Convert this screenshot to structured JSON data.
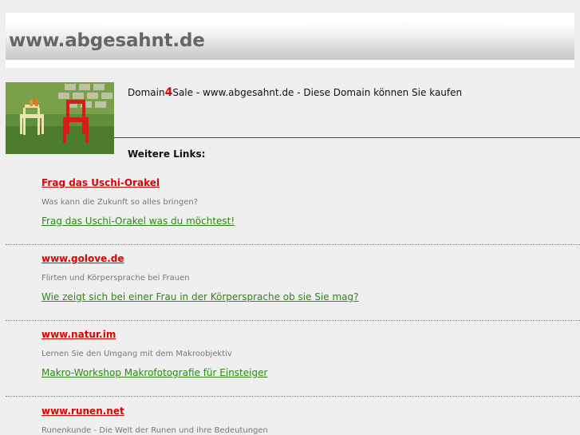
{
  "header": {
    "title": "www.abgesahnt.de"
  },
  "intro": {
    "prefix": "Domain",
    "accent": "4",
    "suffix": "Sale - www.abgesahnt.de - Diese Domain können Sie kaufen"
  },
  "more_links_label": "Weitere Links:",
  "entries": [
    {
      "title": "Frag das Uschi-Orakel",
      "description": "Was kann die Zukunft so alles bringen?",
      "link": "Frag das Uschi-Orakel was du möchtest!"
    },
    {
      "title": "www.golove.de",
      "description": "Flirten und Körpersprache bei Frauen",
      "link": "Wie zeigt sich bei einer Frau in der Körpersprache ob sie Sie mag?"
    },
    {
      "title": "www.natur.im",
      "description": "Lernen Sie den Umgang mit dem Makroobjektiv",
      "link": "Makro-Workshop Makrofotografie für Einsteiger"
    },
    {
      "title": "www.runen.net",
      "description": "Runenkunde - Die Welt der Runen und ihre Bedeutungen",
      "link": ""
    }
  ],
  "colors": {
    "accent": "#e30000",
    "link_green": "#2a8a12",
    "header_text": "#666666"
  }
}
